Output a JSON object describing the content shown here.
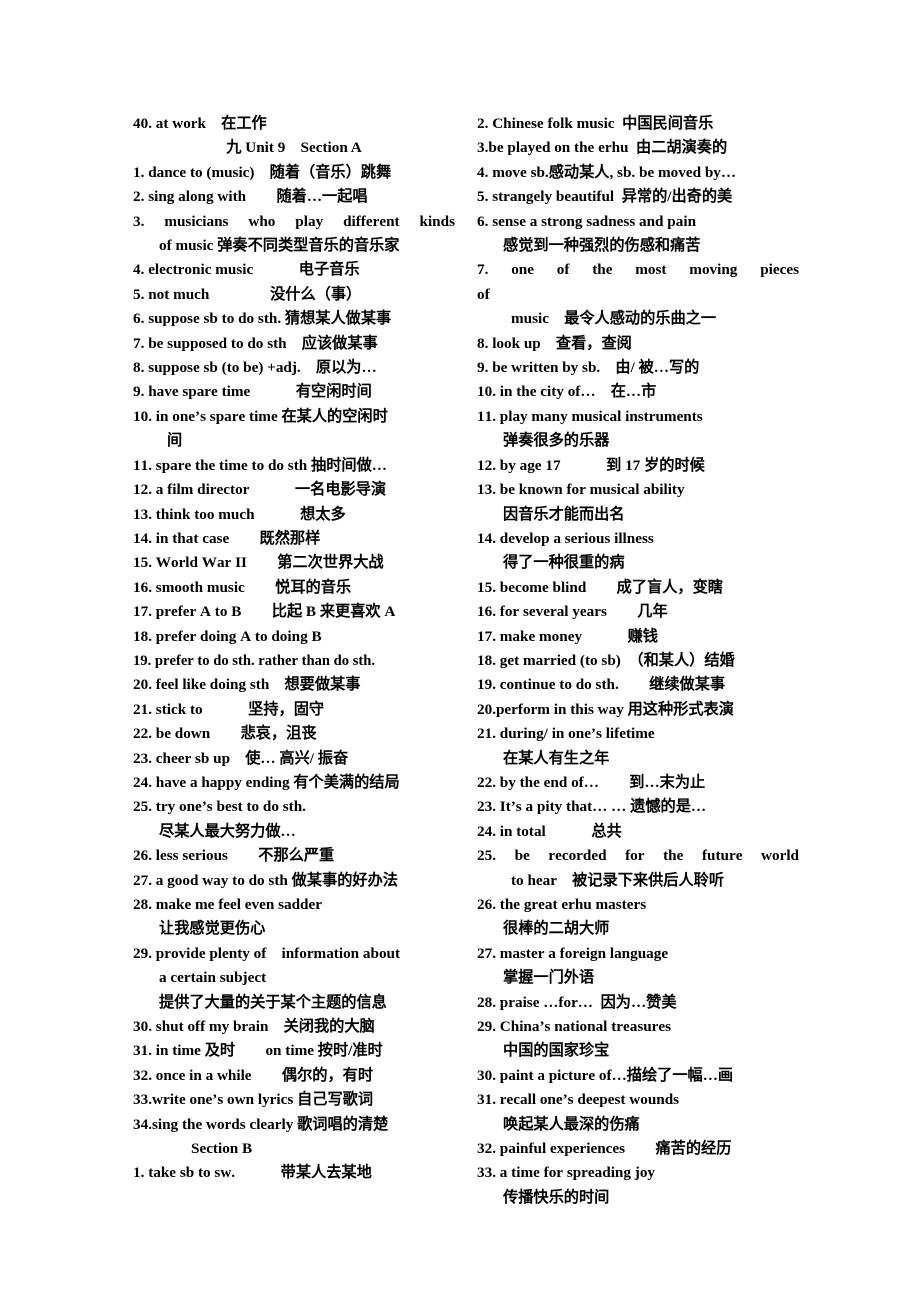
{
  "document": {
    "title": "九 Unit 9  Section A",
    "page_background": "#ffffff",
    "text_color": "#000000"
  },
  "left_column": {
    "carryover_entry": "40. at work　在工作",
    "section_a_heading": "九 Unit 9　Section A",
    "entries": [
      {
        "no": "1.",
        "line1": "1. dance to (music)　随着（音乐）跳舞"
      },
      {
        "no": "2.",
        "line1": "2. sing along with　　随着…一起唱"
      },
      {
        "no": "3.",
        "line1": "3.  musicians  who  play  different  kinds",
        "line2": "of music 弹奏不同类型音乐的音乐家"
      },
      {
        "no": "4.",
        "line1": "4. electronic music　　　电子音乐"
      },
      {
        "no": "5.",
        "line1": "5. not much　　　　没什么（事）"
      },
      {
        "no": "6.",
        "line1": "6. suppose sb to do sth. 猜想某人做某事"
      },
      {
        "no": "7.",
        "line1": "7. be supposed to do sth　应该做某事"
      },
      {
        "no": "8.",
        "line1": "8. suppose sb (to be) +adj.　原以为…"
      },
      {
        "no": "9.",
        "line1": "9. have spare time　　　有空闲时间"
      },
      {
        "no": "10.",
        "line1": "10. in one’s spare time 在某人的空闲时",
        "line2": "间"
      },
      {
        "no": "11.",
        "line1": "11. spare the time to do sth 抽时间做…"
      },
      {
        "no": "12.",
        "line1": "12. a film director　　　一名电影导演"
      },
      {
        "no": "13.",
        "line1": "13. think too much　　　想太多"
      },
      {
        "no": "14.",
        "line1": "14. in that case　　既然那样"
      },
      {
        "no": "15.",
        "line1": "15. World War II　　第二次世界大战"
      },
      {
        "no": "16.",
        "line1": "16. smooth music　　悦耳的音乐"
      },
      {
        "no": "17.",
        "line1": "17. prefer A to B　　比起 B 来更喜欢 A"
      },
      {
        "no": "18.",
        "line1": "18. prefer doing A to doing B"
      },
      {
        "no": "19.",
        "line1": "19. prefer to do sth. rather than do sth."
      },
      {
        "no": "20.",
        "line1": "20. feel like doing sth　想要做某事"
      },
      {
        "no": "21.",
        "line1": "21. stick to　　　坚持，固守"
      },
      {
        "no": "22.",
        "line1": "22. be down　　悲哀，沮丧"
      },
      {
        "no": "23.",
        "line1": "23. cheer sb up　使… 高兴/ 振奋"
      },
      {
        "no": "24.",
        "line1": "24. have a happy ending 有个美满的结局"
      },
      {
        "no": "25.",
        "line1": "25. try one’s best to do sth.",
        "line2": "尽某人最大努力做…"
      },
      {
        "no": "26.",
        "line1": "26. less serious　　不那么严重"
      },
      {
        "no": "27.",
        "line1": "27. a good way to do sth 做某事的好办法"
      },
      {
        "no": "28.",
        "line1": "28. make me feel even sadder",
        "line2": "让我感觉更伤心"
      },
      {
        "no": "29.",
        "line1": "29. provide plenty of　information about",
        "line2": "a certain subject",
        "line3": "提供了大量的关于某个主题的信息"
      },
      {
        "no": "30.",
        "line1": "30. shut off my brain　关闭我的大脑"
      },
      {
        "no": "31.",
        "line1": "31. in time 及时　　on time 按时/准时"
      },
      {
        "no": "32.",
        "line1": "32. once in a while　　偶尔的，有时"
      },
      {
        "no": "33.",
        "line1": "33.write one’s own lyrics 自己写歌词"
      },
      {
        "no": "34.",
        "line1": "34.sing the words clearly 歌词唱的清楚"
      }
    ],
    "section_b_heading": "Section B",
    "section_b_entries": [
      {
        "no": "1.",
        "line1": "1. take sb to sw.　　　带某人去某地"
      }
    ]
  },
  "right_column": {
    "entries": [
      {
        "no": "2.",
        "line1": "2. Chinese folk music  中国民间音乐"
      },
      {
        "no": "3.",
        "line1": "3.be played on the erhu  由二胡演奏的"
      },
      {
        "no": "4.",
        "line1": "4. move sb.感动某人, sb. be moved by…"
      },
      {
        "no": "5.",
        "line1": "5. strangely beautiful  异常的/出奇的美"
      },
      {
        "no": "6.",
        "line1": "6. sense a strong sadness and pain",
        "line2": "感觉到一种强烈的伤感和痛苦"
      },
      {
        "no": "7.",
        "line1": "7.  one  of  the  most  moving  pieces  of",
        "line2": "music　最令人感动的乐曲之一"
      },
      {
        "no": "8.",
        "line1": "8. look up　查看，查阅"
      },
      {
        "no": "9.",
        "line1": "9. be written by sb.　由/ 被…写的"
      },
      {
        "no": "10.",
        "line1": "10. in the city of…　在…市"
      },
      {
        "no": "11.",
        "line1": "11. play many musical instruments",
        "line2": "弹奏很多的乐器"
      },
      {
        "no": "12.",
        "line1": "12. by age 17　　　到 17 岁的时候"
      },
      {
        "no": "13.",
        "line1": "13. be known for musical ability",
        "line2": "因音乐才能而出名"
      },
      {
        "no": "14.",
        "line1": "14. develop a serious illness",
        "line2": "得了一种很重的病"
      },
      {
        "no": "15.",
        "line1": "15. become blind　　成了盲人，变瞎"
      },
      {
        "no": "16.",
        "line1": "16. for several years　　几年"
      },
      {
        "no": "17.",
        "line1": "17. make money　　　赚钱"
      },
      {
        "no": "18.",
        "line1": "18. get married (to sb)　（和某人）结婚"
      },
      {
        "no": "19.",
        "line1": "19. continue to do sth.　　继续做某事"
      },
      {
        "no": "20.",
        "line1": "20.perform in this way 用这种形式表演"
      },
      {
        "no": "21.",
        "line1": "21. during/ in one’s lifetime",
        "line2": "在某人有生之年"
      },
      {
        "no": "22.",
        "line1": "22. by the end of…　　到…末为止"
      },
      {
        "no": "23.",
        "line1": "23. It’s a pity that… … 遗憾的是…"
      },
      {
        "no": "24.",
        "line1": "24. in total　　　总共"
      },
      {
        "no": "25.",
        "line1": "25.  be  recorded  for  the  future  world",
        "line2": "to hear　被记录下来供后人聆听"
      },
      {
        "no": "26.",
        "line1": "26. the great erhu masters",
        "line2": "很棒的二胡大师"
      },
      {
        "no": "27.",
        "line1": "27. master a foreign language",
        "line2": "掌握一门外语"
      },
      {
        "no": "28.",
        "line1": "28. praise …for…  因为…赞美"
      },
      {
        "no": "29.",
        "line1": "29. China’s national treasures",
        "line2": "中国的国家珍宝"
      },
      {
        "no": "30.",
        "line1": "30. paint a picture of…描绘了一幅…画"
      },
      {
        "no": "31.",
        "line1": "31. recall one’s deepest wounds",
        "line2": "唤起某人最深的伤痛"
      },
      {
        "no": "32.",
        "line1": "32. painful experiences　　痛苦的经历"
      },
      {
        "no": "33.",
        "line1": "33. a time for spreading joy",
        "line2": "传播快乐的时间"
      }
    ]
  }
}
